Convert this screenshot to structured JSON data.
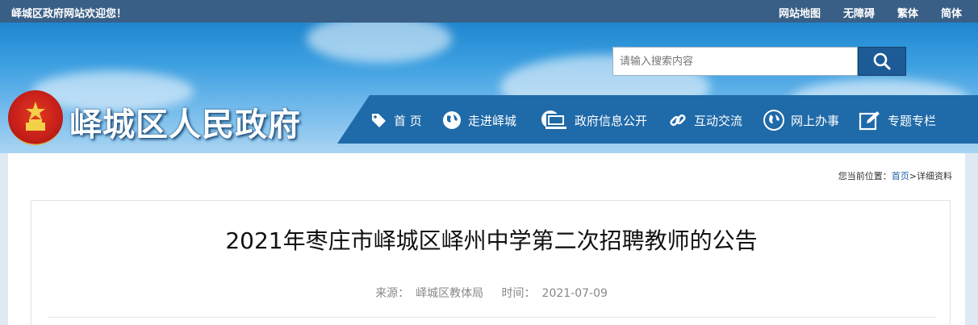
{
  "topbar": {
    "welcome": "峄城区政府网站欢迎您！",
    "links": [
      "网站地图",
      "无障碍",
      "繁体",
      "简体"
    ]
  },
  "search": {
    "placeholder": "请输入搜索内容",
    "icon": "search-icon"
  },
  "site": {
    "title": "峄城区人民政府",
    "emblem": "national-emblem"
  },
  "nav": {
    "items": [
      {
        "label": "首 页",
        "icon": "tag-icon"
      },
      {
        "label": "走进峄城",
        "icon": "globe-icon"
      },
      {
        "label": "政府信息公开",
        "icon": "computer-icon"
      },
      {
        "label": "互动交流",
        "icon": "link-icon"
      },
      {
        "label": "网上办事",
        "icon": "globe-icon"
      },
      {
        "label": "专题专栏",
        "icon": "edit-icon"
      }
    ]
  },
  "breadcrumb": {
    "prefix": "您当前位置：",
    "home": "首页",
    "separator": ">",
    "current": "详细资料"
  },
  "article": {
    "title": "2021年枣庄市峄城区峄州中学第二次招聘教师的公告",
    "source_label": "来源：",
    "source": "峄城区教体局",
    "time_label": "时间：",
    "time": "2021-07-09"
  },
  "colors": {
    "topbar": "#3a5f86",
    "nav": "#1f6aa8",
    "search_button": "#1c5b96"
  }
}
